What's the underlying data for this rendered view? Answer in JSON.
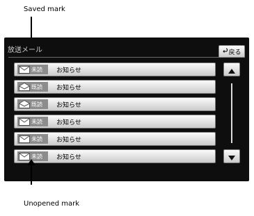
{
  "callouts": {
    "saved": "Saved mark",
    "unopened": "Unopened mark"
  },
  "screen": {
    "title": "放送メール",
    "back_label": "戻る"
  },
  "rows": [
    {
      "status": "未読",
      "subject": "お知らせ",
      "icon": "envelope-closed-icon"
    },
    {
      "status": "既読",
      "subject": "お知らせ",
      "icon": "envelope-open-icon"
    },
    {
      "status": "既読",
      "subject": "お知らせ",
      "icon": "envelope-open-icon"
    },
    {
      "status": "未読",
      "subject": "お知らせ",
      "icon": "envelope-closed-icon"
    },
    {
      "status": "未読",
      "subject": "お知らせ",
      "icon": "envelope-closed-icon"
    },
    {
      "status": "未読",
      "subject": "お知らせ",
      "icon": "envelope-closed-icon"
    }
  ],
  "scroll": {
    "up_icon": "triangle-up-icon",
    "down_icon": "triangle-down-icon"
  }
}
